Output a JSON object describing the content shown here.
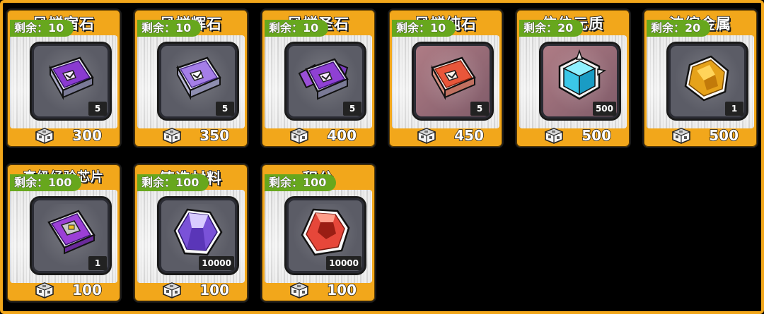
{
  "items": [
    {
      "title": "风燧宿石",
      "remain": "剩余：10",
      "qty": "5",
      "price": "300",
      "icon": "purple-crystal-plate-icon",
      "tile": "gray"
    },
    {
      "title": "风燧辉石",
      "remain": "剩余：10",
      "qty": "5",
      "price": "350",
      "icon": "lavender-crystal-plate-icon",
      "tile": "gray"
    },
    {
      "title": "风燧圣石",
      "remain": "剩余：10",
      "qty": "5",
      "price": "400",
      "icon": "violet-crystal-cluster-icon",
      "tile": "gray"
    },
    {
      "title": "风燧纯石",
      "remain": "剩余：10",
      "qty": "5",
      "price": "450",
      "icon": "red-crystal-plate-icon",
      "tile": "pink"
    },
    {
      "title": "信位元质",
      "remain": "剩余：20",
      "qty": "500",
      "price": "500",
      "icon": "cyan-cube-icon",
      "tile": "pink"
    },
    {
      "title": "浓缩金属",
      "remain": "剩余：20",
      "qty": "1",
      "price": "500",
      "icon": "gold-ore-icon",
      "tile": "gray"
    },
    {
      "title": "高级经验芯片",
      "remain": "剩余：100",
      "qty": "1",
      "price": "100",
      "icon": "purple-chip-icon",
      "tile": "gray"
    },
    {
      "title": "铸造材料",
      "remain": "剩余：100",
      "qty": "10000",
      "price": "100",
      "icon": "purple-gem-icon",
      "tile": "gray"
    },
    {
      "title": "积分",
      "remain": "剩余：100",
      "qty": "10000",
      "price": "100",
      "icon": "red-gem-icon",
      "tile": "gray"
    }
  ],
  "currency_icon": "cube-currency-icon",
  "colors": {
    "card": "#f2a71b",
    "remain_badge": "#67a71d",
    "frame": "#f2a71b"
  }
}
